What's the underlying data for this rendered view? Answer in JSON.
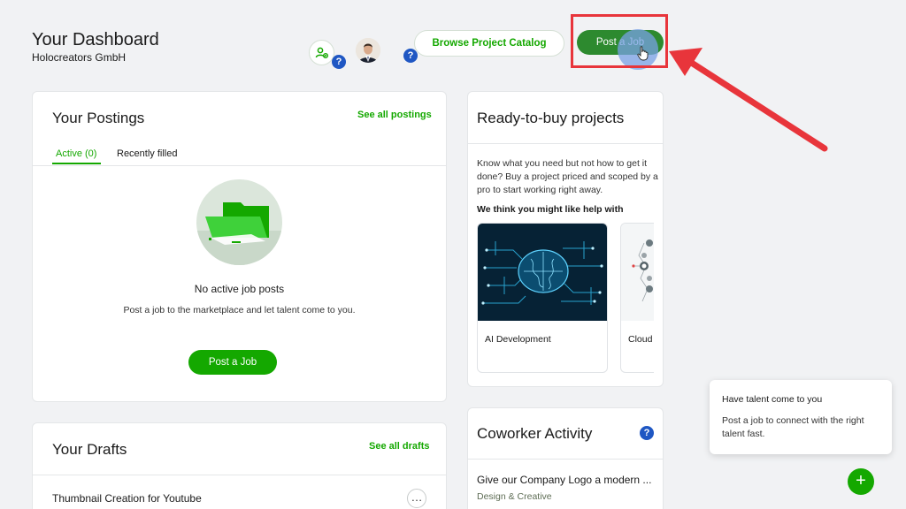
{
  "header": {
    "title": "Your Dashboard",
    "company": "Holocreators GmbH",
    "help_label": "?",
    "browse_button": "Browse Project Catalog",
    "post_job_button": "Post a Job"
  },
  "postings": {
    "title": "Your Postings",
    "see_all": "See all postings",
    "tabs": [
      {
        "label": "Active (0)",
        "active": true
      },
      {
        "label": "Recently filled",
        "active": false
      }
    ],
    "empty_title": "No active job posts",
    "empty_desc": "Post a job to the marketplace and let talent come to you.",
    "post_button": "Post a Job"
  },
  "drafts": {
    "title": "Your Drafts",
    "see_all": "See all drafts",
    "items": [
      {
        "title": "Thumbnail Creation for Youtube",
        "more_label": "…"
      }
    ]
  },
  "ready_to_buy": {
    "title": "Ready-to-buy projects",
    "description": "Know what you need but not how to get it done? Buy a project priced and scoped by a pro to start working right away.",
    "subheading": "We think you might like help with",
    "projects": [
      {
        "label": "AI Development"
      },
      {
        "label": "Cloud"
      }
    ]
  },
  "coworker": {
    "title": "Coworker Activity",
    "help_label": "?",
    "item_title": "Give our Company Logo a modern ...",
    "item_category": "Design & Creative"
  },
  "tooltip": {
    "title": "Have talent come to you",
    "body": "Post a job to connect with the right talent fast."
  },
  "fab": {
    "label": "+"
  },
  "colors": {
    "accent": "#14a800",
    "highlight": "#e8353b",
    "help_blue": "#1f57c3"
  },
  "icons": [
    "team-icon",
    "help-icon",
    "avatar",
    "cursor-hand-icon",
    "pointer-arrow",
    "more-icon",
    "plus-icon"
  ]
}
